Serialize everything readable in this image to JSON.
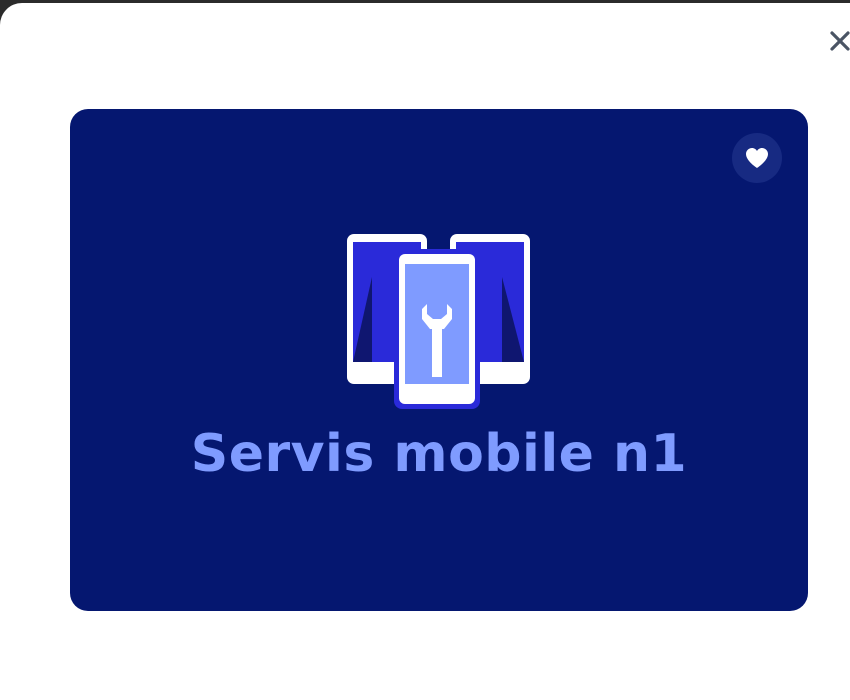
{
  "modal": {
    "close_icon": "close-icon"
  },
  "card": {
    "background": "#051770",
    "favorite_icon": "heart-icon",
    "logo_icon": "phones-wrench-icon",
    "brand_name": "Servis mobile n1",
    "brand_color": "#7f9bff"
  }
}
